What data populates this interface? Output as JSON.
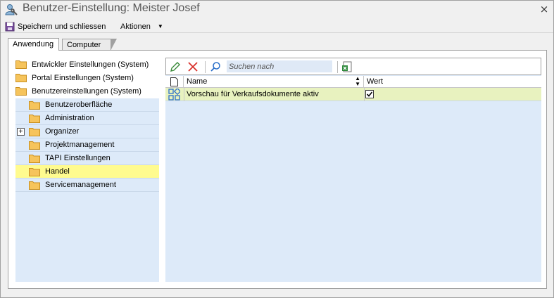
{
  "window": {
    "title": "Benutzer-Einstellung: Meister Josef",
    "close_label": "×"
  },
  "toolbar": {
    "save_label": "Speichern und schliessen",
    "actions_label": "Aktionen",
    "actions_caret": "▼"
  },
  "tabs": [
    {
      "label": "Anwendung",
      "active": true
    },
    {
      "label": "Computer",
      "active": false
    }
  ],
  "tree": {
    "top_items": [
      {
        "label": "Entwickler Einstellungen (System)"
      },
      {
        "label": "Portal Einstellungen (System)"
      },
      {
        "label": "Benutzereinstellungen (System)"
      }
    ],
    "children": [
      {
        "label": "Benutzeroberfläche",
        "expandable": false,
        "selected": false
      },
      {
        "label": "Administration",
        "expandable": false,
        "selected": false
      },
      {
        "label": "Organizer",
        "expandable": true,
        "selected": false
      },
      {
        "label": "Projektmanagement",
        "expandable": false,
        "selected": false
      },
      {
        "label": "TAPI Einstellungen",
        "expandable": false,
        "selected": false
      },
      {
        "label": "Handel",
        "expandable": false,
        "selected": true
      },
      {
        "label": "Servicemanagement",
        "expandable": false,
        "selected": false
      }
    ],
    "expander_glyph": "+"
  },
  "grid": {
    "search_placeholder": "Suchen nach",
    "columns": {
      "name": "Name",
      "wert": "Wert"
    },
    "rows": [
      {
        "name": "Vorschau für Verkaufsdokumente aktiv",
        "wert_checked": true
      }
    ]
  },
  "colors": {
    "selected_row": "#fffb8f",
    "grid_row": "#e8f2bf",
    "panel_blue": "#ddeaf9",
    "delete_red": "#d9322c",
    "accent_blue": "#2a6fc9"
  }
}
